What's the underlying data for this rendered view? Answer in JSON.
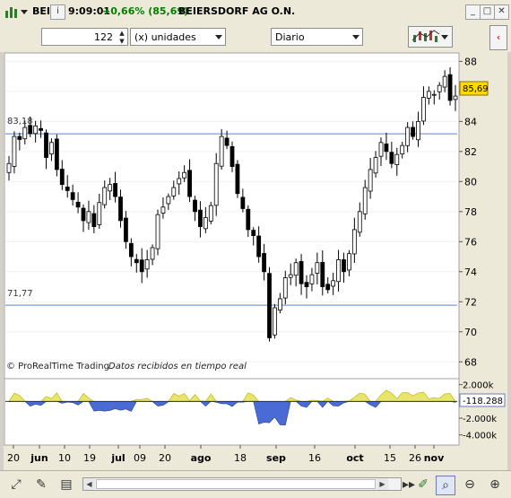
{
  "titlebar": {
    "ticker": "BEI",
    "time": "9:09:01",
    "change": "+0,66% (85,69)",
    "name": "BEIERSDORF AG O.N.",
    "change_color": "#008000"
  },
  "toolbar": {
    "quantity": "122",
    "unit_label": "(x) unidades",
    "period": "Diario"
  },
  "chart": {
    "price_label": "85,69",
    "line_label_upper": "83,18",
    "line_label_lower": "71,77",
    "watermark_brand": "© ProRealTime Trading",
    "watermark_text": "Datos recibidos en tiempo real",
    "indicator_value": "-118.288",
    "indicator_ticks": [
      "2.000k",
      "0",
      "-2.000k",
      "-4.000k"
    ],
    "x_labels": [
      "20",
      "jun",
      "10",
      "19",
      "jul",
      "09",
      "20",
      "ago",
      "18",
      "sep",
      "16",
      "oct",
      "15",
      "26",
      "nov"
    ]
  },
  "chart_data": {
    "type": "candlestick",
    "title": "BEIERSDORF AG O.N.",
    "ylim": [
      67,
      88.5
    ],
    "y_ticks": [
      68,
      70,
      72,
      74,
      76,
      78,
      80,
      82,
      84,
      86,
      88
    ],
    "horizontal_lines": [
      83.18,
      71.77
    ],
    "last_price": 85.69,
    "x_tick_labels": [
      "20",
      "jun",
      "10",
      "19",
      "jul",
      "09",
      "20",
      "ago",
      "18",
      "sep",
      "16",
      "oct",
      "15",
      "26",
      "nov"
    ],
    "close": [
      81.2,
      83.0,
      82.8,
      83.6,
      83.2,
      83.7,
      83.4,
      81.6,
      82.6,
      80.8,
      79.8,
      79.4,
      78.8,
      78.3,
      77.4,
      78.0,
      77.0,
      78.6,
      79.6,
      79.8,
      79.0,
      77.4,
      76.0,
      75.0,
      74.6,
      74.0,
      74.8,
      75.6,
      77.8,
      78.3,
      79.0,
      79.6,
      80.2,
      80.6,
      79.0,
      78.0,
      77.0,
      77.6,
      78.4,
      81.2,
      83.0,
      82.4,
      81.0,
      79.2,
      78.2,
      76.8,
      76.4,
      75.0,
      74.0,
      69.6,
      71.6,
      72.2,
      73.6,
      73.8,
      74.6,
      73.2,
      73.0,
      73.8,
      74.6,
      73.0,
      72.8,
      73.4,
      74.8,
      74.0,
      75.2,
      76.8,
      78.0,
      79.6,
      80.8,
      81.6,
      82.6,
      82.0,
      81.2,
      81.8,
      82.4,
      83.6,
      83.0,
      84.0,
      85.6,
      86.0,
      85.8,
      86.4,
      87.0,
      85.4,
      85.69
    ],
    "indicator": {
      "name": "volume oscillator",
      "last_value": -118.288,
      "ylim": [
        -5000,
        2500
      ]
    }
  }
}
